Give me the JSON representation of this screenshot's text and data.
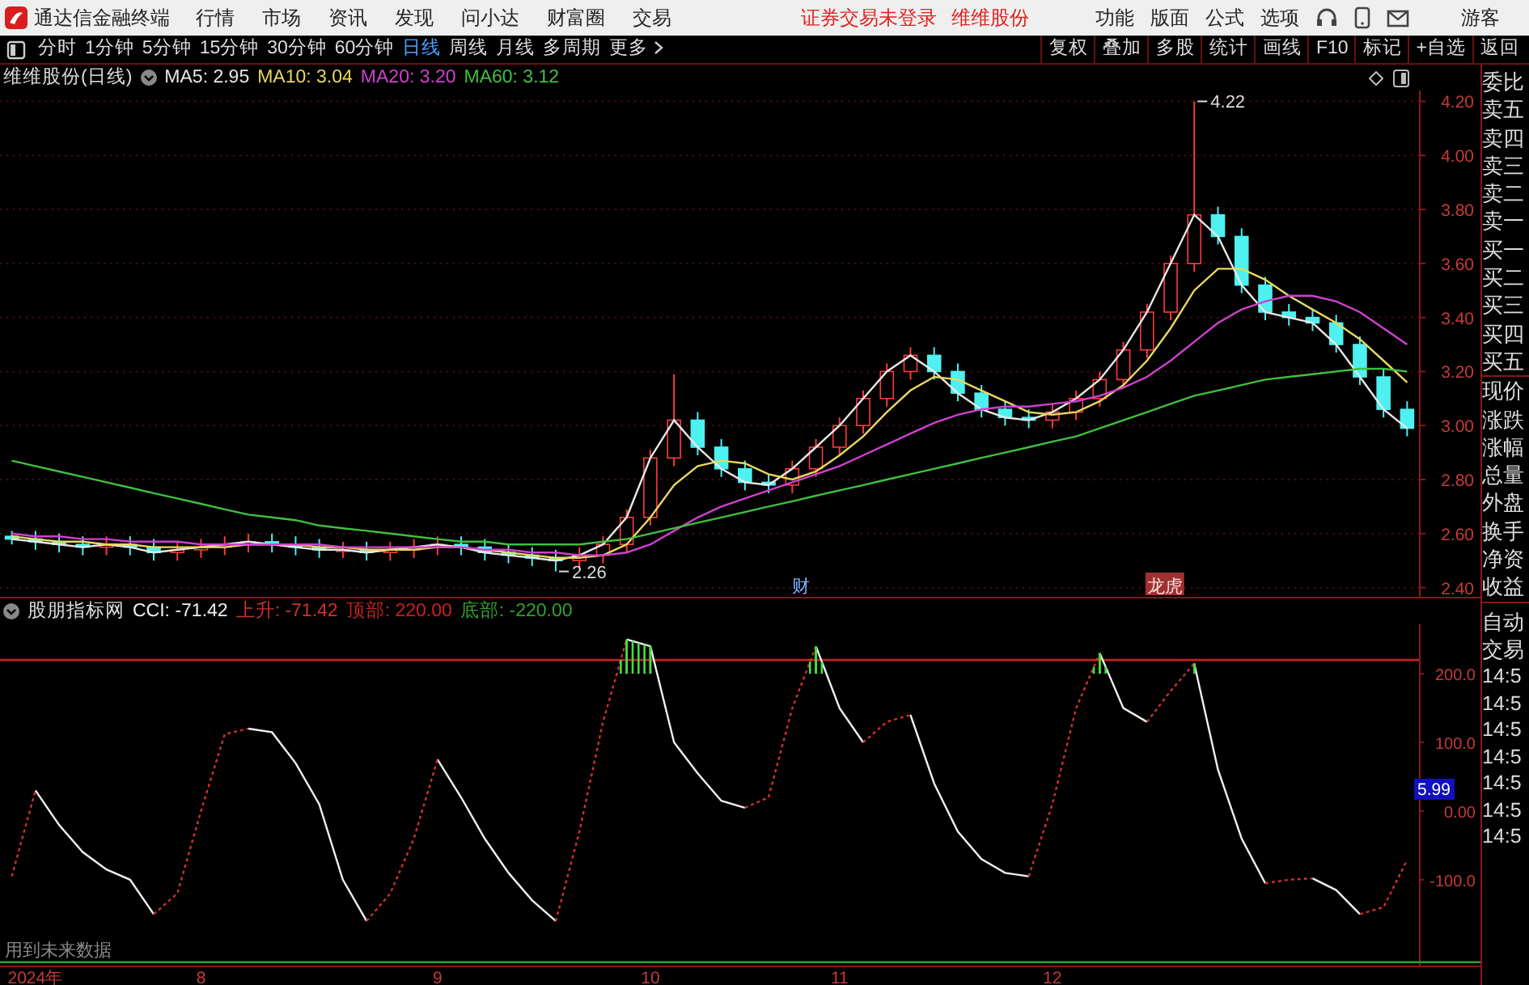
{
  "app": {
    "title": "通达信金融终端"
  },
  "menu": [
    "行情",
    "市场",
    "资讯",
    "发现",
    "问小达",
    "财富圈",
    "交易"
  ],
  "notices": [
    "证券交易未登录",
    "维维股份"
  ],
  "top_right_menu": [
    "功能",
    "版面",
    "公式",
    "选项"
  ],
  "user": "游客",
  "periods": [
    {
      "label": "分时",
      "selected": false,
      "kind": "period"
    },
    {
      "label": "1分钟",
      "selected": false,
      "kind": "period"
    },
    {
      "label": "5分钟",
      "selected": false,
      "kind": "period"
    },
    {
      "label": "15分钟",
      "selected": false,
      "kind": "period"
    },
    {
      "label": "30分钟",
      "selected": false,
      "kind": "period"
    },
    {
      "label": "60分钟",
      "selected": false,
      "kind": "period"
    },
    {
      "label": "日线",
      "selected": true,
      "kind": "period"
    },
    {
      "label": "周线",
      "selected": false,
      "kind": "period"
    },
    {
      "label": "月线",
      "selected": false,
      "kind": "period"
    },
    {
      "label": "多周期",
      "selected": false,
      "kind": "period"
    },
    {
      "label": "更多",
      "selected": false,
      "kind": "dropdown"
    }
  ],
  "tools": [
    "复权",
    "叠加",
    "多股",
    "统计",
    "画线",
    "F10",
    "标记",
    "+自选",
    "返回"
  ],
  "price_pane": {
    "title": "维维股份(日线)",
    "high_label": "4.22",
    "low_label": "2.26",
    "events": [
      {
        "text": "财",
        "kind": "plain",
        "color": "#7fb0ff"
      },
      {
        "text": "龙虎",
        "kind": "tag",
        "color": "#a03030"
      }
    ],
    "chart_data": {
      "type": "candlestick",
      "grid": true,
      "ylim": [
        2.36,
        4.24
      ],
      "categories": [
        null,
        null,
        null,
        null,
        null,
        null,
        null,
        null,
        null,
        null,
        null,
        null,
        null,
        null,
        null,
        null,
        null,
        null,
        null,
        null,
        null,
        null,
        null,
        null,
        null,
        null,
        null,
        null,
        null,
        null,
        null,
        null,
        null,
        null,
        null,
        null,
        null,
        null,
        null,
        null,
        null,
        null,
        null,
        null,
        null,
        null,
        null,
        null,
        null,
        null,
        null,
        null,
        null,
        null,
        null,
        null,
        null,
        null,
        null,
        null
      ],
      "yticks": [
        {
          "value": 4.2,
          "label": "4.20"
        },
        {
          "value": 4.0,
          "label": "4.00"
        },
        {
          "value": 3.8,
          "label": "3.80"
        },
        {
          "value": 3.6,
          "label": "3.60"
        },
        {
          "value": 3.4,
          "label": "3.40"
        },
        {
          "value": 3.2,
          "label": "3.20"
        },
        {
          "value": 3.0,
          "label": "3.00"
        },
        {
          "value": 2.8,
          "label": "2.80"
        },
        {
          "value": 2.6,
          "label": "2.60"
        },
        {
          "value": 2.4,
          "label": "2.40"
        }
      ],
      "ohlc": [
        [
          2.59,
          2.61,
          2.56,
          2.58
        ],
        [
          2.58,
          2.61,
          2.54,
          2.57
        ],
        [
          2.57,
          2.6,
          2.53,
          2.56
        ],
        [
          2.56,
          2.59,
          2.52,
          2.55
        ],
        [
          2.55,
          2.59,
          2.52,
          2.56
        ],
        [
          2.56,
          2.59,
          2.52,
          2.55
        ],
        [
          2.55,
          2.58,
          2.5,
          2.53
        ],
        [
          2.53,
          2.57,
          2.5,
          2.54
        ],
        [
          2.54,
          2.58,
          2.51,
          2.55
        ],
        [
          2.55,
          2.59,
          2.52,
          2.56
        ],
        [
          2.56,
          2.6,
          2.53,
          2.57
        ],
        [
          2.57,
          2.6,
          2.53,
          2.56
        ],
        [
          2.56,
          2.59,
          2.52,
          2.55
        ],
        [
          2.55,
          2.58,
          2.51,
          2.54
        ],
        [
          2.54,
          2.57,
          2.51,
          2.54
        ],
        [
          2.54,
          2.57,
          2.5,
          2.53
        ],
        [
          2.53,
          2.57,
          2.5,
          2.54
        ],
        [
          2.54,
          2.58,
          2.51,
          2.55
        ],
        [
          2.55,
          2.59,
          2.52,
          2.56
        ],
        [
          2.56,
          2.59,
          2.52,
          2.55
        ],
        [
          2.55,
          2.58,
          2.5,
          2.53
        ],
        [
          2.53,
          2.56,
          2.49,
          2.52
        ],
        [
          2.52,
          2.55,
          2.48,
          2.51
        ],
        [
          2.51,
          2.54,
          2.46,
          2.5
        ],
        [
          2.5,
          2.55,
          2.47,
          2.52
        ],
        [
          2.52,
          2.59,
          2.49,
          2.56
        ],
        [
          2.56,
          2.69,
          2.53,
          2.66
        ],
        [
          2.66,
          2.91,
          2.63,
          2.88
        ],
        [
          2.88,
          3.19,
          2.85,
          3.02
        ],
        [
          3.02,
          3.05,
          2.89,
          2.92
        ],
        [
          2.92,
          2.95,
          2.81,
          2.84
        ],
        [
          2.84,
          2.87,
          2.76,
          2.79
        ],
        [
          2.79,
          2.82,
          2.75,
          2.78
        ],
        [
          2.78,
          2.87,
          2.75,
          2.84
        ],
        [
          2.84,
          2.95,
          2.81,
          2.92
        ],
        [
          2.92,
          3.03,
          2.89,
          3.0
        ],
        [
          3.0,
          3.13,
          2.97,
          3.1
        ],
        [
          3.1,
          3.23,
          3.07,
          3.2
        ],
        [
          3.2,
          3.29,
          3.17,
          3.26
        ],
        [
          3.26,
          3.29,
          3.17,
          3.2
        ],
        [
          3.2,
          3.23,
          3.09,
          3.12
        ],
        [
          3.12,
          3.15,
          3.03,
          3.06
        ],
        [
          3.06,
          3.09,
          3.0,
          3.03
        ],
        [
          3.03,
          3.06,
          2.99,
          3.02
        ],
        [
          3.02,
          3.08,
          2.99,
          3.05
        ],
        [
          3.05,
          3.13,
          3.02,
          3.1
        ],
        [
          3.1,
          3.2,
          3.07,
          3.17
        ],
        [
          3.17,
          3.31,
          3.14,
          3.28
        ],
        [
          3.28,
          3.45,
          3.25,
          3.42
        ],
        [
          3.42,
          3.63,
          3.39,
          3.6
        ],
        [
          3.6,
          4.2,
          3.57,
          3.78
        ],
        [
          3.78,
          3.81,
          3.67,
          3.7
        ],
        [
          3.7,
          3.73,
          3.49,
          3.52
        ],
        [
          3.52,
          3.55,
          3.39,
          3.42
        ],
        [
          3.42,
          3.45,
          3.37,
          3.4
        ],
        [
          3.4,
          3.43,
          3.35,
          3.38
        ],
        [
          3.38,
          3.41,
          3.27,
          3.3
        ],
        [
          3.3,
          3.33,
          3.15,
          3.18
        ],
        [
          3.18,
          3.21,
          3.03,
          3.06
        ],
        [
          3.06,
          3.09,
          2.96,
          2.99
        ]
      ],
      "series": [
        {
          "name": "MA5: 2.95",
          "type": "line",
          "color": "#e8e8e8",
          "values": [
            2.58,
            2.57,
            2.56,
            2.55,
            2.56,
            2.55,
            2.53,
            2.54,
            2.55,
            2.56,
            2.57,
            2.56,
            2.55,
            2.54,
            2.54,
            2.53,
            2.54,
            2.55,
            2.56,
            2.55,
            2.53,
            2.52,
            2.51,
            2.5,
            2.52,
            2.56,
            2.66,
            2.88,
            3.02,
            2.92,
            2.84,
            2.79,
            2.78,
            2.84,
            2.92,
            3.0,
            3.1,
            3.2,
            3.26,
            3.2,
            3.12,
            3.06,
            3.03,
            3.02,
            3.05,
            3.1,
            3.17,
            3.28,
            3.42,
            3.6,
            3.78,
            3.7,
            3.52,
            3.42,
            3.4,
            3.38,
            3.3,
            3.18,
            3.06,
            2.99
          ]
        },
        {
          "name": "MA10: 3.04",
          "type": "line",
          "color": "#e8d860",
          "values": [
            2.59,
            2.58,
            2.57,
            2.57,
            2.56,
            2.56,
            2.55,
            2.55,
            2.55,
            2.55,
            2.56,
            2.56,
            2.56,
            2.55,
            2.55,
            2.54,
            2.54,
            2.54,
            2.55,
            2.55,
            2.54,
            2.53,
            2.52,
            2.51,
            2.51,
            2.52,
            2.56,
            2.66,
            2.78,
            2.85,
            2.87,
            2.86,
            2.82,
            2.8,
            2.83,
            2.89,
            2.96,
            3.05,
            3.13,
            3.18,
            3.17,
            3.13,
            3.09,
            3.05,
            3.04,
            3.05,
            3.09,
            3.15,
            3.24,
            3.36,
            3.5,
            3.58,
            3.58,
            3.54,
            3.48,
            3.43,
            3.38,
            3.32,
            3.24,
            3.16
          ]
        },
        {
          "name": "MA20: 3.20",
          "type": "line",
          "color": "#d040d0",
          "values": [
            2.6,
            2.59,
            2.59,
            2.58,
            2.58,
            2.57,
            2.57,
            2.57,
            2.56,
            2.56,
            2.56,
            2.56,
            2.56,
            2.56,
            2.55,
            2.55,
            2.55,
            2.55,
            2.55,
            2.55,
            2.54,
            2.54,
            2.53,
            2.53,
            2.52,
            2.52,
            2.53,
            2.56,
            2.61,
            2.66,
            2.7,
            2.73,
            2.76,
            2.79,
            2.82,
            2.85,
            2.89,
            2.93,
            2.97,
            3.01,
            3.04,
            3.06,
            3.07,
            3.07,
            3.08,
            3.09,
            3.11,
            3.14,
            3.18,
            3.24,
            3.31,
            3.38,
            3.43,
            3.46,
            3.48,
            3.48,
            3.46,
            3.42,
            3.36,
            3.3
          ]
        },
        {
          "name": "MA60: 3.12",
          "type": "line",
          "color": "#40c040",
          "values": [
            2.87,
            2.85,
            2.83,
            2.81,
            2.79,
            2.77,
            2.75,
            2.73,
            2.71,
            2.69,
            2.67,
            2.66,
            2.65,
            2.63,
            2.62,
            2.61,
            2.6,
            2.59,
            2.58,
            2.57,
            2.57,
            2.56,
            2.56,
            2.56,
            2.56,
            2.57,
            2.58,
            2.6,
            2.62,
            2.64,
            2.66,
            2.68,
            2.7,
            2.72,
            2.74,
            2.76,
            2.78,
            2.8,
            2.82,
            2.84,
            2.86,
            2.88,
            2.9,
            2.92,
            2.94,
            2.96,
            2.99,
            3.02,
            3.05,
            3.08,
            3.11,
            3.13,
            3.15,
            3.17,
            3.18,
            3.19,
            3.2,
            3.21,
            3.21,
            3.2
          ]
        }
      ]
    }
  },
  "indicator_pane": {
    "title": "股朋指标网",
    "note": "用到未来数据",
    "marker": "5.99",
    "chart_data": {
      "type": "line",
      "ylim": [
        -225,
        272
      ],
      "categories": [
        null,
        "2024年",
        null,
        null,
        null,
        null,
        null,
        null,
        "8",
        null,
        null,
        null,
        null,
        null,
        null,
        null,
        null,
        null,
        "9",
        null,
        null,
        null,
        null,
        null,
        null,
        null,
        null,
        "10",
        null,
        null,
        null,
        null,
        null,
        null,
        null,
        "11",
        null,
        null,
        null,
        null,
        null,
        null,
        null,
        null,
        "12",
        null,
        null,
        null,
        null,
        null,
        null,
        null,
        null,
        null,
        null,
        null,
        null,
        null,
        null,
        null
      ],
      "yticks": [
        {
          "value": 200,
          "label": "200.0"
        },
        {
          "value": 100,
          "label": "100.0"
        },
        {
          "value": 0,
          "label": "0.00"
        },
        {
          "value": -100,
          "label": "-100.0"
        }
      ],
      "series": [
        {
          "name": "CCI: -71.42",
          "color": "#f0f0f0",
          "values": [
            null,
            30,
            -20,
            -60,
            -85,
            -100,
            -150,
            null,
            null,
            null,
            120,
            115,
            70,
            10,
            -100,
            -160,
            null,
            null,
            75,
            20,
            -40,
            -90,
            -130,
            -160,
            null,
            null,
            250,
            240,
            100,
            55,
            15,
            5,
            null,
            null,
            240,
            150,
            100,
            null,
            140,
            40,
            -30,
            -70,
            -90,
            -95,
            null,
            null,
            230,
            150,
            130,
            null,
            215,
            60,
            -40,
            -105,
            null,
            -98,
            -115,
            -150,
            null,
            null
          ]
        },
        {
          "name": "上升: -71.42",
          "color": "#d03030",
          "line_style": "dashed",
          "values": [
            -95,
            30,
            null,
            null,
            null,
            null,
            -150,
            -120,
            0,
            112,
            120,
            null,
            null,
            null,
            null,
            -160,
            -120,
            -40,
            75,
            null,
            null,
            null,
            null,
            -160,
            -30,
            130,
            250,
            null,
            null,
            null,
            null,
            5,
            20,
            150,
            240,
            null,
            100,
            130,
            140,
            null,
            null,
            null,
            null,
            -95,
            10,
            150,
            230,
            null,
            130,
            175,
            215,
            null,
            null,
            -105,
            -100,
            -98,
            null,
            -150,
            -140,
            -71
          ]
        }
      ],
      "ref_lines": [
        {
          "axis": "y",
          "value": 220,
          "label": "顶部: 220.00",
          "color": "#c82020"
        },
        {
          "axis": "y",
          "value": -220,
          "label": "底部: -220.00",
          "color": "#30a030"
        }
      ]
    }
  },
  "quote_panel": {
    "labels": [
      "委比",
      "卖五",
      "卖四",
      "卖三",
      "卖二",
      "卖一",
      "买一",
      "买二",
      "买三",
      "买四",
      "买五",
      "现价",
      "涨跌",
      "涨幅",
      "总量",
      "外盘",
      "换手",
      "净资",
      "收益"
    ],
    "trade_labels": [
      "自动",
      "交易"
    ],
    "times": [
      "14:5",
      "14:5",
      "14:5",
      "14:5",
      "14:5",
      "14:5",
      "14:5"
    ]
  }
}
